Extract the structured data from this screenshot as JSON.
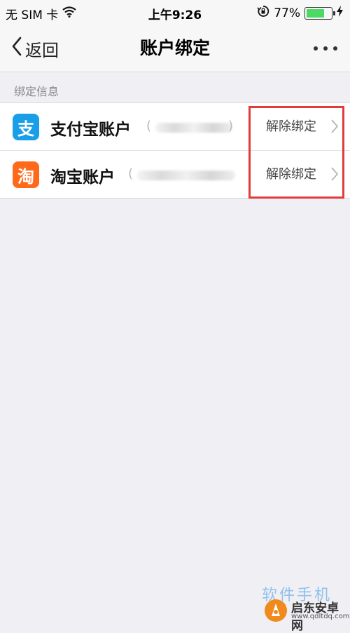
{
  "status_bar": {
    "carrier": "无 SIM 卡",
    "time": "上午9:26",
    "battery_percent": "77%",
    "battery_level": 0.77,
    "icons": [
      "wifi-icon",
      "rotation-lock-icon",
      "battery-icon",
      "charging-icon"
    ]
  },
  "nav": {
    "back_label": "返回",
    "title": "账户绑定",
    "more_icon": "more-dots-icon"
  },
  "section": {
    "label": "绑定信息"
  },
  "accounts": [
    {
      "name": "支付宝账户",
      "icon_glyph": "支",
      "icon_color": "#1a9ee8",
      "paren_open": "(",
      "paren_close": ")",
      "action": "解除绑定"
    },
    {
      "name": "淘宝账户",
      "icon_glyph": "淘",
      "icon_color": "#ff6a1a",
      "paren_open": "(",
      "action": "解除绑定"
    }
  ],
  "colors": {
    "highlight_box": "#e23b3b",
    "background": "#efeff4"
  },
  "watermark": {
    "top_text": "软件手机",
    "name": "启东安卓网",
    "url": "www.qdltdq.com"
  }
}
